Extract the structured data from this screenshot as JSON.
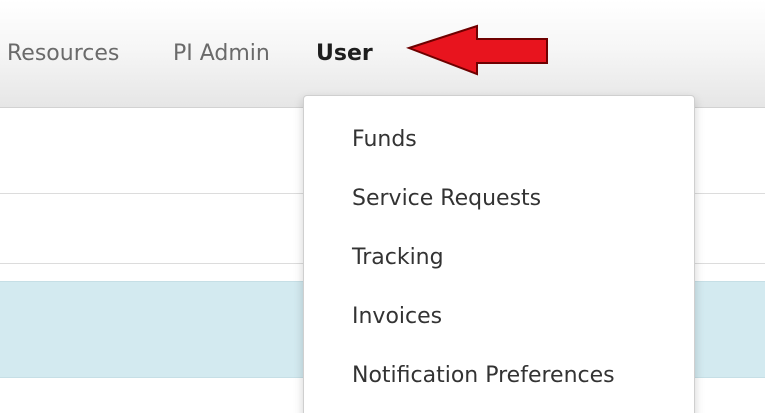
{
  "navbar": {
    "items": [
      {
        "label": "Resources"
      },
      {
        "label": "PI Admin"
      },
      {
        "label": "User"
      }
    ]
  },
  "user_menu": {
    "items": [
      {
        "label": "Funds"
      },
      {
        "label": "Service Requests"
      },
      {
        "label": "Tracking"
      },
      {
        "label": "Invoices"
      },
      {
        "label": "Notification Preferences"
      }
    ]
  },
  "annotation": {
    "icon": "red-arrow-icon",
    "color": "#e8141e"
  },
  "colors": {
    "navbar_bg": "#efefef",
    "highlight_row": "#d3eaf0",
    "active_nav_text": "#1e1e1e",
    "nav_text": "#6a6a6a"
  }
}
